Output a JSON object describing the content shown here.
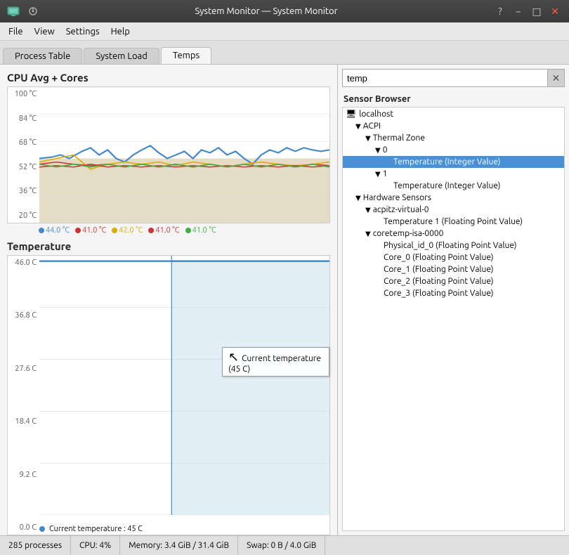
{
  "titlebar": {
    "title": "System Monitor — System Monitor",
    "help_btn": "?",
    "minimize_btn": "−",
    "maximize_btn": "□",
    "close_btn": "✕"
  },
  "menubar": {
    "items": [
      "File",
      "View",
      "Settings",
      "Help"
    ]
  },
  "tabs": [
    {
      "label": "Process Table",
      "active": false
    },
    {
      "label": "System Load",
      "active": false
    },
    {
      "label": "Temps",
      "active": true
    }
  ],
  "left": {
    "cpu_chart": {
      "title": "CPU Avg + Cores",
      "y_labels": [
        "100 °C",
        "84 °C",
        "68 °C",
        "52 °C",
        "36 °C",
        "20 °C"
      ]
    },
    "cpu_legend": [
      {
        "color": "#4488cc",
        "value": "44.0 °C",
        "dot": false
      },
      {
        "color": "#cc3333",
        "dot": true,
        "value": "41.0 °C"
      },
      {
        "color": "#ddaa00",
        "dot": false,
        "value": "42.0 °C"
      },
      {
        "color": "#cc3333",
        "dot": true,
        "value": "41.0 °C"
      },
      {
        "color": "#44aa44",
        "dot": false,
        "value": "41.0 °C"
      }
    ],
    "temp_chart": {
      "title": "Temperature",
      "y_labels": [
        "46.0 C",
        "36.8 C",
        "27.6 C",
        "18.4 C",
        "9.2 C",
        "0.0 C"
      ]
    },
    "temp_legend": [
      {
        "color": "#4488cc",
        "dot": true,
        "value": "Current temperature : 45 C"
      }
    ],
    "tooltip": "Current temperature (45 C)"
  },
  "right": {
    "search_placeholder": "temp",
    "sensor_browser_label": "Sensor Browser",
    "tree": [
      {
        "indent": 0,
        "icon": "monitor",
        "arrow": "",
        "label": "localhost",
        "selected": false
      },
      {
        "indent": 1,
        "arrow": "▼",
        "label": "ACPI",
        "selected": false
      },
      {
        "indent": 2,
        "arrow": "▼",
        "label": "Thermal Zone",
        "selected": false
      },
      {
        "indent": 3,
        "arrow": "▼",
        "label": "0",
        "selected": false
      },
      {
        "indent": 4,
        "arrow": "",
        "label": "Temperature (Integer Value)",
        "selected": true
      },
      {
        "indent": 3,
        "arrow": "▼",
        "label": "1",
        "selected": false
      },
      {
        "indent": 4,
        "arrow": "",
        "label": "Temperature (Integer Value)",
        "selected": false
      },
      {
        "indent": 1,
        "arrow": "▼",
        "label": "Hardware Sensors",
        "selected": false
      },
      {
        "indent": 2,
        "arrow": "▼",
        "label": "acpitz-virtual-0",
        "selected": false
      },
      {
        "indent": 3,
        "arrow": "",
        "label": "Temperature 1 (Floating Point Value)",
        "selected": false
      },
      {
        "indent": 2,
        "arrow": "▼",
        "label": "coretemp-isa-0000",
        "selected": false
      },
      {
        "indent": 3,
        "arrow": "",
        "label": "Physical_id_0 (Floating Point Value)",
        "selected": false
      },
      {
        "indent": 3,
        "arrow": "",
        "label": "Core_0 (Floating Point Value)",
        "selected": false
      },
      {
        "indent": 3,
        "arrow": "",
        "label": "Core_1 (Floating Point Value)",
        "selected": false
      },
      {
        "indent": 3,
        "arrow": "",
        "label": "Core_2 (Floating Point Value)",
        "selected": false
      },
      {
        "indent": 3,
        "arrow": "",
        "label": "Core_3 (Floating Point Value)",
        "selected": false
      }
    ]
  },
  "statusbar": {
    "processes": "285 processes",
    "cpu": "CPU: 4%",
    "memory": "Memory: 3.4 GiB / 31.4 GiB",
    "swap": "Swap: 0 B / 4.0 GiB"
  }
}
